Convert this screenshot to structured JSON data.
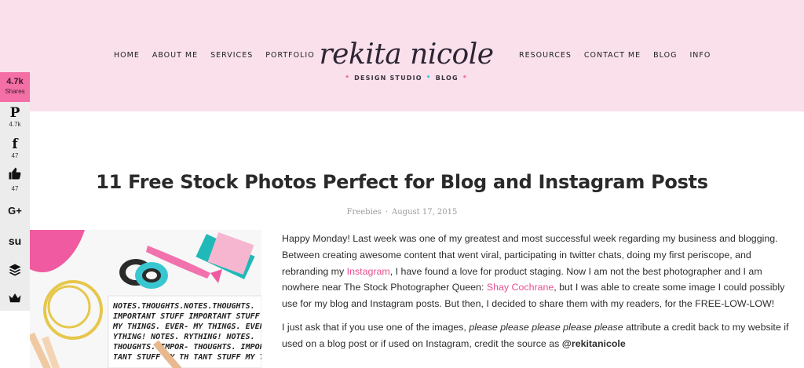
{
  "nav": {
    "left": [
      "HOME",
      "ABOUT ME",
      "SERVICES",
      "PORTFOLIO"
    ],
    "right": [
      "RESOURCES",
      "CONTACT ME",
      "BLOG",
      "INFO"
    ]
  },
  "logo": {
    "script": "rekita nicole",
    "tag_left": "DESIGN STUDIO",
    "tag_right": "BLOG"
  },
  "share": {
    "total": "4.7k",
    "total_label": "Shares",
    "items": [
      {
        "icon": "pinterest-icon",
        "glyph": "P",
        "count": "4.7k"
      },
      {
        "icon": "facebook-icon",
        "glyph": "f",
        "count": "47"
      },
      {
        "icon": "like-icon",
        "glyph": "👍",
        "count": "47"
      },
      {
        "icon": "google-plus-icon",
        "glyph": "G+",
        "count": ""
      },
      {
        "icon": "stumbleupon-icon",
        "glyph": "su",
        "count": ""
      },
      {
        "icon": "buffer-icon",
        "glyph": "≋",
        "count": ""
      },
      {
        "icon": "crown-icon",
        "glyph": "♛",
        "count": ""
      }
    ]
  },
  "post": {
    "title": "11 Free Stock Photos Perfect for Blog and Instagram Posts",
    "category": "Freebies",
    "separator": "·",
    "date": "August 17, 2015",
    "p1_a": "Happy Monday! Last week was one of my greatest and most successful week regarding my business and blogging. Between creating awesome content that went viral, participating in twitter chats, doing my first periscope, and rebranding my ",
    "p1_link1": "Instagram",
    "p1_b": ", I have found a love for product staging. Now I am not the best photographer and I am nowhere near The Stock Photographer Queen: ",
    "p1_link2": "Shay Cochrane",
    "p1_c": ", but I was able to create some image I could possibly use for my blog and Instagram posts. But then, I decided to share them with my readers, for the FREE-LOW-LOW!",
    "p2_a": "I just ask that if you use one of the images, ",
    "p2_em": "please please please please please",
    "p2_b": " attribute a credit back to my website if used on a blog post or if used on Instagram, credit the source as ",
    "p2_strong": "@rekitanicole"
  },
  "colors": {
    "header_bg": "#f9e0ea",
    "accent_pink": "#f36fa6",
    "link": "#e6508f",
    "accent_blue": "#3cc6d4"
  }
}
